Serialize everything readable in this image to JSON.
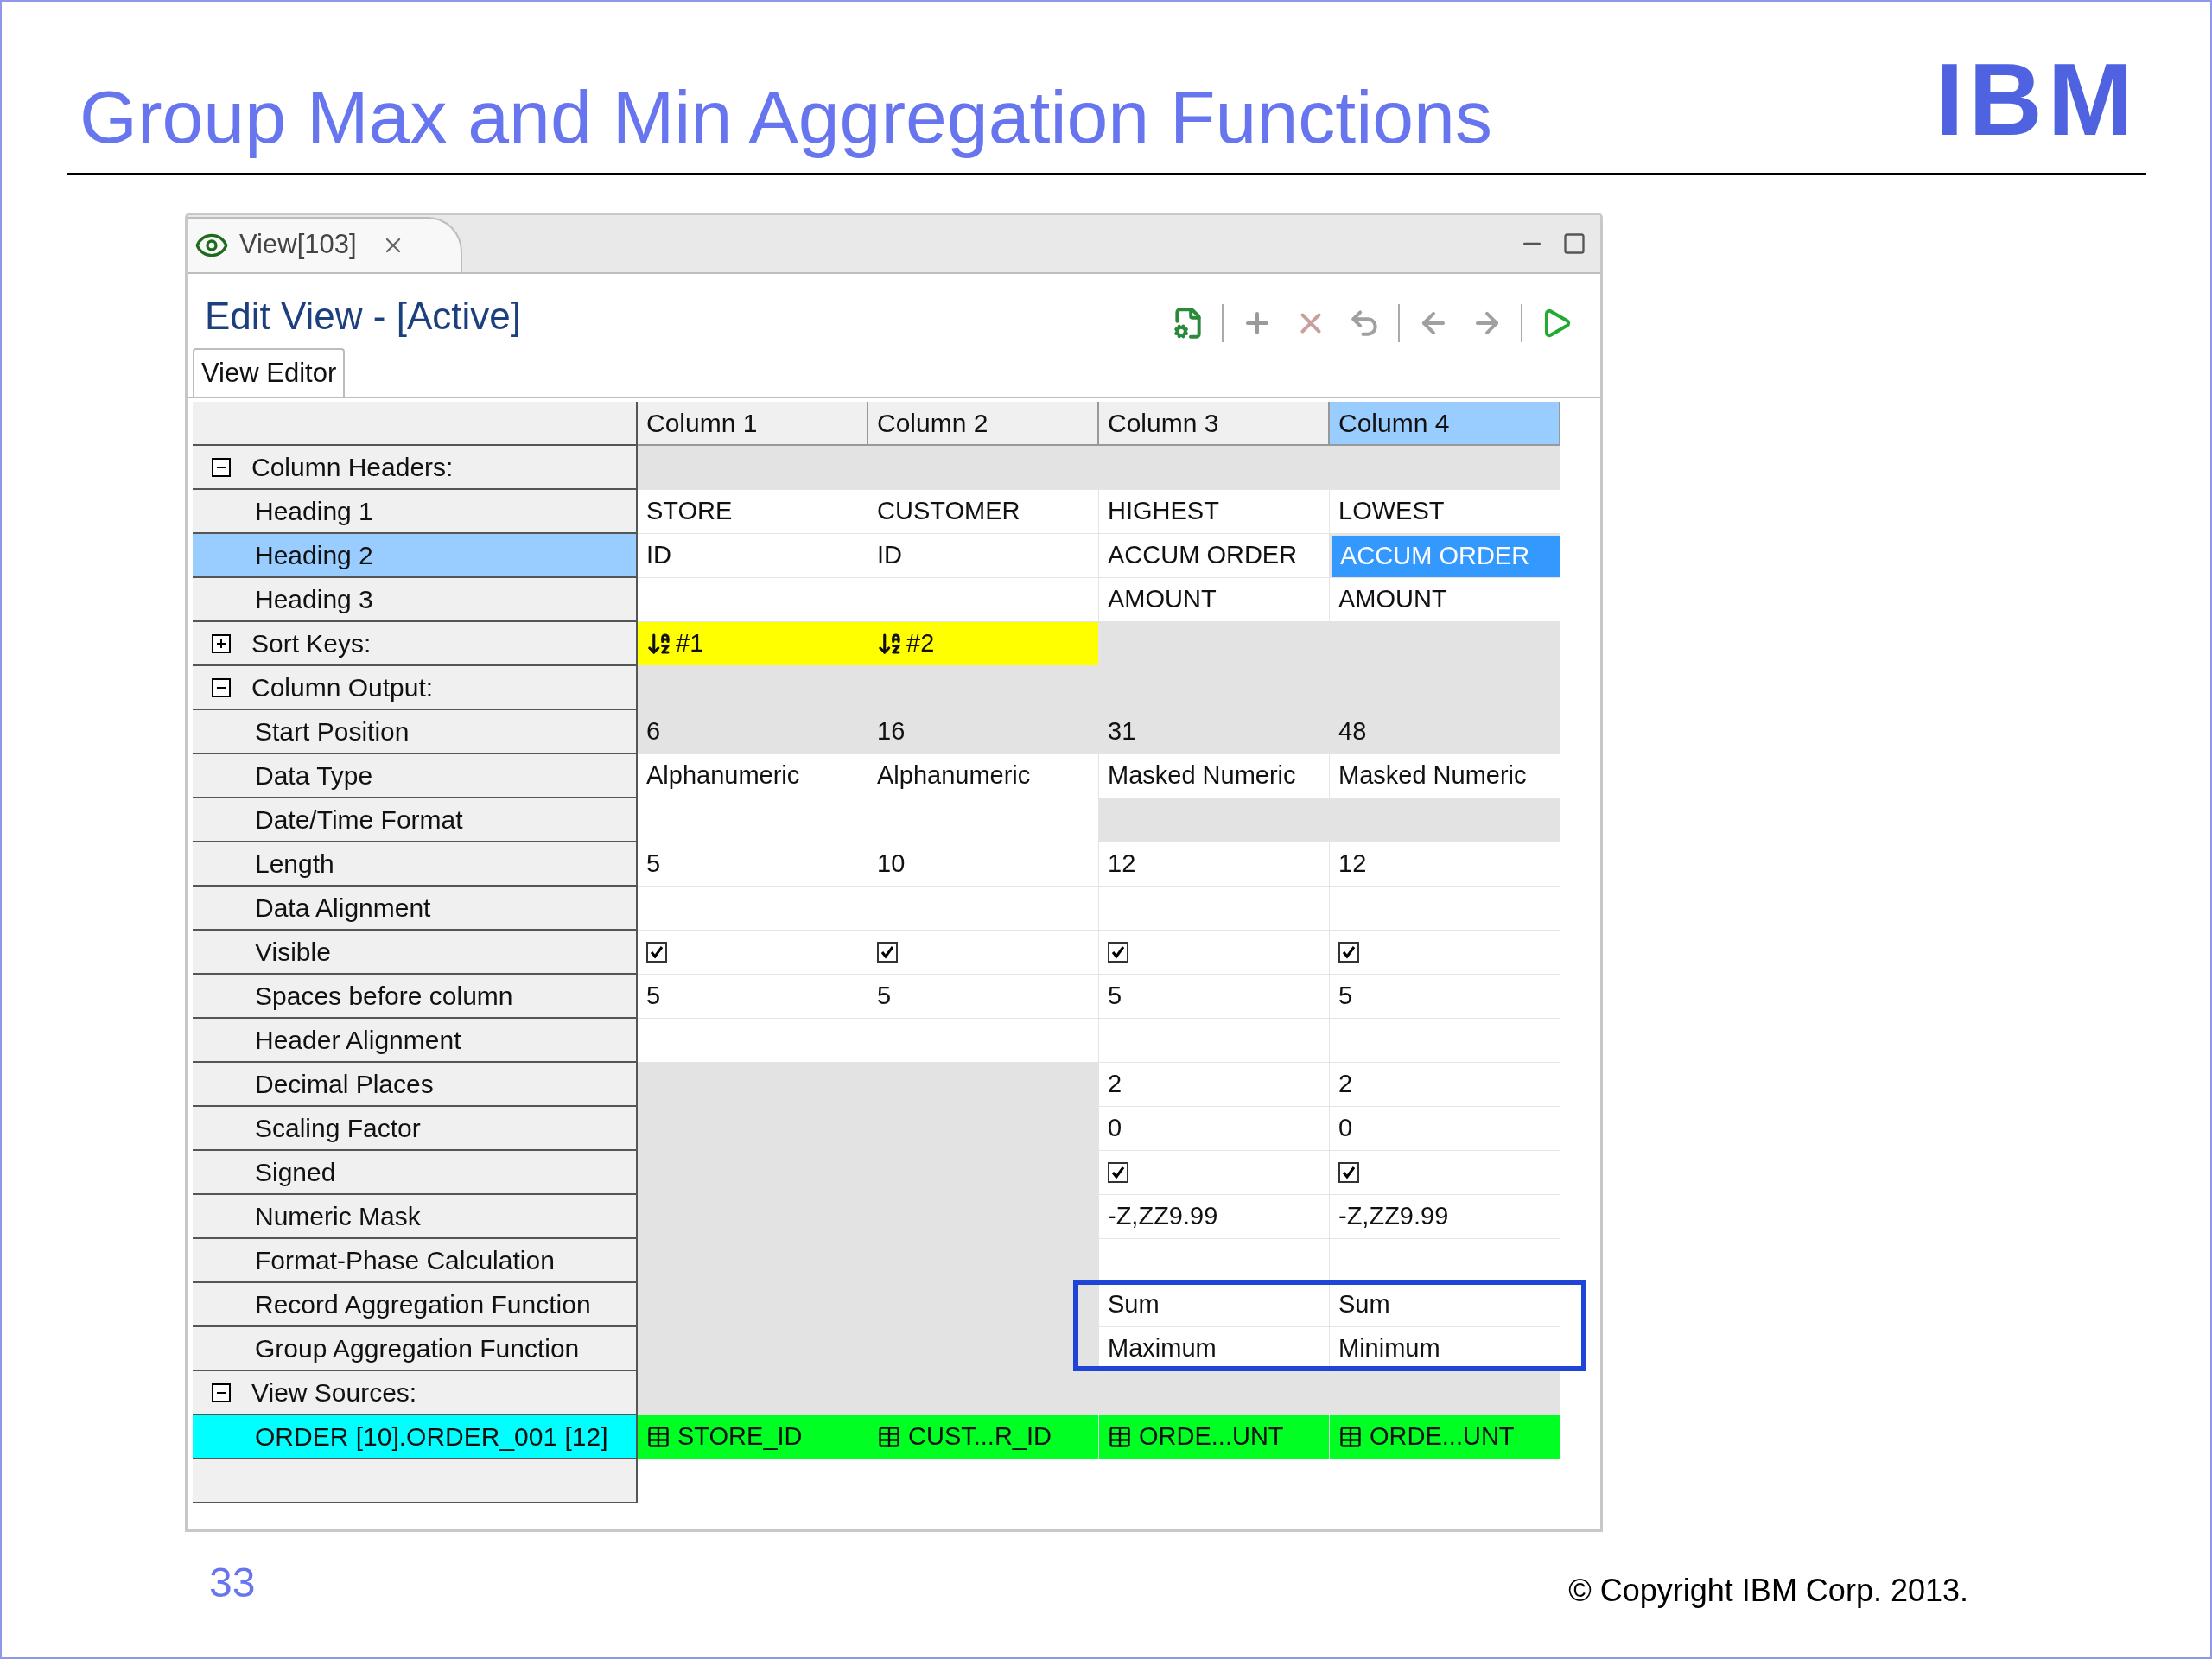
{
  "slide": {
    "title": "Group Max and Min Aggregation Functions",
    "logo": "IBM",
    "page_number": "33",
    "copyright": "© Copyright IBM Corp. 2013."
  },
  "window": {
    "tab": {
      "label": "View[103]",
      "selected": true
    },
    "heading": "Edit View - [Active]",
    "subtabs": [
      {
        "label": "View Editor",
        "selected": true
      }
    ]
  },
  "columns": [
    {
      "label": "Column 1",
      "selected": false
    },
    {
      "label": "Column 2",
      "selected": false
    },
    {
      "label": "Column 3",
      "selected": false
    },
    {
      "label": "Column 4",
      "selected": true
    }
  ],
  "rows": [
    {
      "kind": "section",
      "label": "Column Headers:",
      "expanded": true,
      "selected": false,
      "cells": [
        {
          "kind": "text",
          "disabled": true
        },
        {
          "kind": "text",
          "disabled": true
        },
        {
          "kind": "text",
          "disabled": true
        },
        {
          "kind": "text",
          "disabled": true
        }
      ]
    },
    {
      "kind": "property",
      "label": "Heading 1",
      "selected": false,
      "cells": [
        {
          "kind": "text",
          "text": "STORE",
          "disabled": false
        },
        {
          "kind": "text",
          "text": "CUSTOMER",
          "disabled": false
        },
        {
          "kind": "text",
          "text": "HIGHEST",
          "disabled": false
        },
        {
          "kind": "text",
          "text": "LOWEST",
          "disabled": false
        }
      ]
    },
    {
      "kind": "property",
      "label": "Heading 2",
      "selected": true,
      "cells": [
        {
          "kind": "text",
          "text": "ID",
          "disabled": false
        },
        {
          "kind": "text",
          "text": "ID",
          "disabled": false
        },
        {
          "kind": "text",
          "text": "ACCUM ORDER",
          "disabled": false
        },
        {
          "kind": "text",
          "text": "ACCUM ORDER",
          "disabled": false
        }
      ]
    },
    {
      "kind": "property",
      "label": "Heading 3",
      "selected": false,
      "cells": [
        {
          "kind": "text",
          "disabled": false
        },
        {
          "kind": "text",
          "disabled": false
        },
        {
          "kind": "text",
          "text": "AMOUNT",
          "disabled": false
        },
        {
          "kind": "text",
          "text": "AMOUNT",
          "disabled": false
        }
      ]
    },
    {
      "kind": "section",
      "label": "Sort Keys:",
      "expanded": false,
      "selected": false,
      "cells": [
        {
          "kind": "sort",
          "text": "#1"
        },
        {
          "kind": "sort",
          "text": "#2"
        },
        {
          "kind": "text",
          "disabled": true
        },
        {
          "kind": "text",
          "disabled": true
        }
      ]
    },
    {
      "kind": "section",
      "label": "Column Output:",
      "expanded": true,
      "selected": false,
      "cells": [
        {
          "kind": "text",
          "disabled": true
        },
        {
          "kind": "text",
          "disabled": true
        },
        {
          "kind": "text",
          "disabled": true
        },
        {
          "kind": "text",
          "disabled": true
        }
      ]
    },
    {
      "kind": "property",
      "label": "Start Position",
      "selected": false,
      "cells": [
        {
          "kind": "text",
          "text": "6",
          "disabled": true
        },
        {
          "kind": "text",
          "text": "16",
          "disabled": true
        },
        {
          "kind": "text",
          "text": "31",
          "disabled": true
        },
        {
          "kind": "text",
          "text": "48",
          "disabled": true
        }
      ]
    },
    {
      "kind": "property",
      "label": "Data Type",
      "selected": false,
      "cells": [
        {
          "kind": "text",
          "text": "Alphanumeric",
          "disabled": false
        },
        {
          "kind": "text",
          "text": "Alphanumeric",
          "disabled": false
        },
        {
          "kind": "text",
          "text": "Masked Numeric",
          "disabled": false
        },
        {
          "kind": "text",
          "text": "Masked Numeric",
          "disabled": false
        }
      ]
    },
    {
      "kind": "property",
      "label": "Date/Time Format",
      "selected": false,
      "cells": [
        {
          "kind": "text",
          "disabled": false
        },
        {
          "kind": "text",
          "disabled": false
        },
        {
          "kind": "text",
          "disabled": true
        },
        {
          "kind": "text",
          "disabled": true
        }
      ]
    },
    {
      "kind": "property",
      "label": "Length",
      "selected": false,
      "cells": [
        {
          "kind": "text",
          "text": "5",
          "disabled": false
        },
        {
          "kind": "text",
          "text": "10",
          "disabled": false
        },
        {
          "kind": "text",
          "text": "12",
          "disabled": false
        },
        {
          "kind": "text",
          "text": "12",
          "disabled": false
        }
      ]
    },
    {
      "kind": "property",
      "label": "Data Alignment",
      "selected": false,
      "cells": [
        {
          "kind": "text",
          "disabled": false
        },
        {
          "kind": "text",
          "disabled": false
        },
        {
          "kind": "text",
          "disabled": false
        },
        {
          "kind": "text",
          "disabled": false
        }
      ]
    },
    {
      "kind": "property",
      "label": "Visible",
      "selected": false,
      "cells": [
        {
          "kind": "checkbox",
          "checked": true,
          "disabled": false
        },
        {
          "kind": "checkbox",
          "checked": true,
          "disabled": false
        },
        {
          "kind": "checkbox",
          "checked": true,
          "disabled": false
        },
        {
          "kind": "checkbox",
          "checked": true,
          "disabled": false
        }
      ]
    },
    {
      "kind": "property",
      "label": "Spaces before column",
      "selected": false,
      "cells": [
        {
          "kind": "text",
          "text": "5",
          "disabled": false
        },
        {
          "kind": "text",
          "text": "5",
          "disabled": false
        },
        {
          "kind": "text",
          "text": "5",
          "disabled": false
        },
        {
          "kind": "text",
          "text": "5",
          "disabled": false
        }
      ]
    },
    {
      "kind": "property",
      "label": "Header Alignment",
      "selected": false,
      "cells": [
        {
          "kind": "text",
          "disabled": false
        },
        {
          "kind": "text",
          "disabled": false
        },
        {
          "kind": "text",
          "disabled": false
        },
        {
          "kind": "text",
          "disabled": false
        }
      ]
    },
    {
      "kind": "property",
      "label": "Decimal Places",
      "selected": false,
      "cells": [
        {
          "kind": "text",
          "disabled": true
        },
        {
          "kind": "text",
          "disabled": true
        },
        {
          "kind": "text",
          "text": "2",
          "disabled": false
        },
        {
          "kind": "text",
          "text": "2",
          "disabled": false
        }
      ]
    },
    {
      "kind": "property",
      "label": "Scaling Factor",
      "selected": false,
      "cells": [
        {
          "kind": "text",
          "disabled": true
        },
        {
          "kind": "text",
          "disabled": true
        },
        {
          "kind": "text",
          "text": "0",
          "disabled": false
        },
        {
          "kind": "text",
          "text": "0",
          "disabled": false
        }
      ]
    },
    {
      "kind": "property",
      "label": "Signed",
      "selected": false,
      "cells": [
        {
          "kind": "text",
          "disabled": true
        },
        {
          "kind": "text",
          "disabled": true
        },
        {
          "kind": "checkbox",
          "checked": true,
          "disabled": false
        },
        {
          "kind": "checkbox",
          "checked": true,
          "disabled": false
        }
      ]
    },
    {
      "kind": "property",
      "label": "Numeric Mask",
      "selected": false,
      "cells": [
        {
          "kind": "text",
          "disabled": true
        },
        {
          "kind": "text",
          "disabled": true
        },
        {
          "kind": "text",
          "text": "-Z,ZZ9.99",
          "disabled": false
        },
        {
          "kind": "text",
          "text": "-Z,ZZ9.99",
          "disabled": false
        }
      ]
    },
    {
      "kind": "property",
      "label": "Format-Phase Calculation",
      "selected": false,
      "cells": [
        {
          "kind": "text",
          "disabled": true
        },
        {
          "kind": "text",
          "disabled": true
        },
        {
          "kind": "text",
          "disabled": false
        },
        {
          "kind": "text",
          "disabled": false
        }
      ]
    },
    {
      "kind": "property",
      "label": "Record Aggregation Function",
      "selected": false,
      "cells": [
        {
          "kind": "text",
          "disabled": true
        },
        {
          "kind": "text",
          "disabled": true
        },
        {
          "kind": "text",
          "text": "Sum",
          "disabled": false,
          "boxed": true
        },
        {
          "kind": "text",
          "text": "Sum",
          "disabled": false,
          "boxed": true
        }
      ]
    },
    {
      "kind": "property",
      "label": "Group Aggregation Function",
      "selected": false,
      "cells": [
        {
          "kind": "text",
          "disabled": true
        },
        {
          "kind": "text",
          "disabled": true
        },
        {
          "kind": "text",
          "text": "Maximum",
          "disabled": false,
          "boxed": true
        },
        {
          "kind": "text",
          "text": "Minimum",
          "disabled": false,
          "boxed": true
        }
      ]
    },
    {
      "kind": "section",
      "label": "View Sources:",
      "expanded": true,
      "selected": false,
      "cells": [
        {
          "kind": "text",
          "disabled": true
        },
        {
          "kind": "text",
          "disabled": true
        },
        {
          "kind": "text",
          "disabled": true
        },
        {
          "kind": "text",
          "disabled": true
        }
      ]
    },
    {
      "kind": "source",
      "label": "ORDER [10].ORDER_001 [12]",
      "selected": false,
      "cells": [
        {
          "kind": "source",
          "text": "STORE_ID"
        },
        {
          "kind": "source",
          "text": "CUST...R_ID"
        },
        {
          "kind": "source",
          "text": "ORDE...UNT"
        },
        {
          "kind": "source",
          "text": "ORDE...UNT"
        }
      ]
    }
  ]
}
